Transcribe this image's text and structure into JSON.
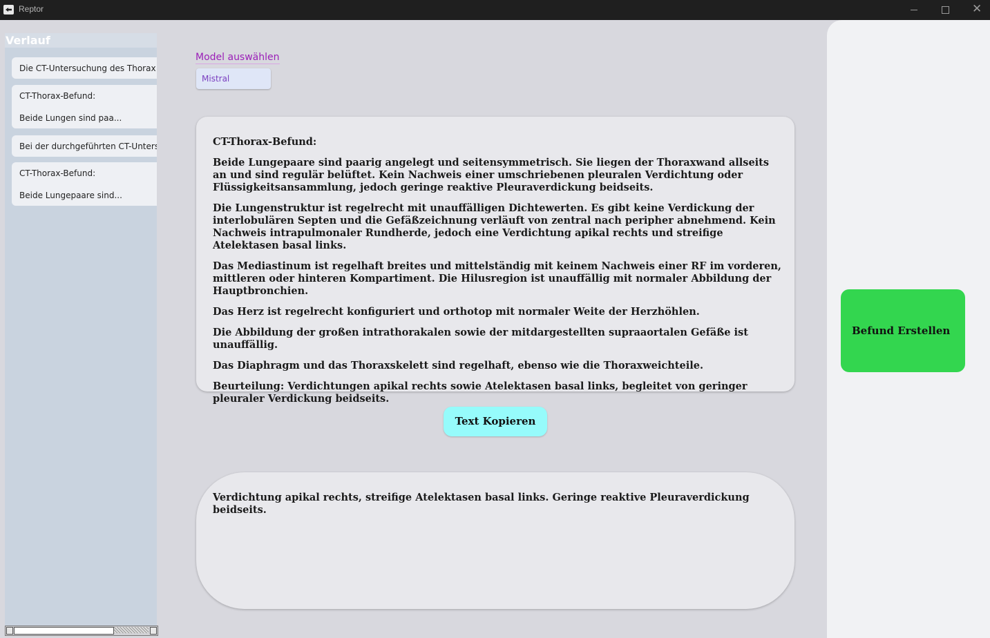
{
  "window": {
    "title": "Reptor"
  },
  "sidebar": {
    "title": "Verlauf",
    "items": [
      {
        "lines": [
          "Die CT-Untersuchung des Thorax z"
        ]
      },
      {
        "lines": [
          "CT-Thorax-Befund:",
          "Beide Lungen sind paa..."
        ]
      },
      {
        "lines": [
          "Bei der durchgeführten CT-Untersu"
        ]
      },
      {
        "lines": [
          "CT-Thorax-Befund:",
          "Beide Lungepaare sind..."
        ]
      }
    ]
  },
  "model": {
    "label": "Model auswählen",
    "selected": "Mistral"
  },
  "report": {
    "paragraphs": [
      "CT-Thorax-Befund:",
      "Beide Lungepaare sind paarig angelegt und seitensymmetrisch. Sie liegen der Thoraxwand allseits an und sind regulär belüftet. Kein Nachweis einer umschriebenen pleuralen Verdichtung oder Flüssigkeitsansammlung, jedoch geringe reaktive Pleuraverdickung beidseits.",
      "Die Lungenstruktur ist regelrecht mit unauffälligen Dichtewerten. Es gibt keine Verdickung der interlobulären Septen und die Gefäßzeichnung verläuft von zentral nach peripher abnehmend. Kein Nachweis intrapulmonaler Rundherde, jedoch eine Verdichtung apikal rechts und streifige Atelektasen basal links.",
      "Das Mediastinum ist regelhaft breites und mittelständig mit keinem Nachweis einer RF im vorderen, mittleren oder hinteren Kompartiment. Die Hilusregion ist unauffällig mit normaler Abbildung der Hauptbronchien.",
      "Das Herz ist regelrecht konfiguriert und orthotop mit normaler Weite der Herzhöhlen.",
      "Die Abbildung der großen intrathorakalen sowie der mitdargestellten supraaortalen Gefäße ist unauffällig.",
      "Das Diaphragm und das Thoraxskelett sind regelhaft, ebenso wie die Thoraxweichteile.",
      "Beurteilung: Verdichtungen apikal rechts sowie Atelektasen basal links, begleitet von geringer pleuraler Verdickung beidseits."
    ]
  },
  "copy_button": "Text Kopieren",
  "summary": {
    "text": "Verdichtung apikal rechts, streifige Atelektasen basal links. Geringe reaktive Pleuraverdickung beidseits."
  },
  "create_button": "Befund Erstellen",
  "colors": {
    "create_button": "#33d64f",
    "copy_button": "#96fbfb",
    "model_label": "#9b1fb8"
  }
}
